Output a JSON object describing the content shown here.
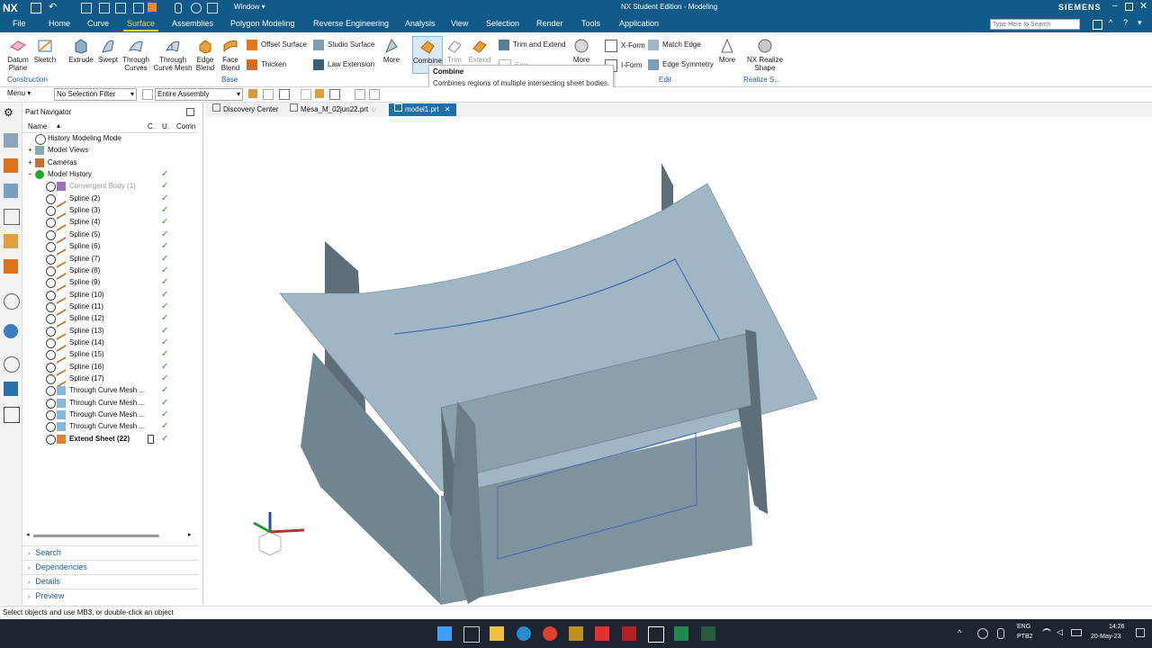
{
  "titlebar": {
    "app": "NX",
    "window_menu": "Window ▾",
    "title": "NX Student Edition - Modeling",
    "brand": "SIEMENS",
    "search_placeholder": "Type Here to Search"
  },
  "menu": {
    "file": "File",
    "tabs": [
      "Home",
      "Curve",
      "Surface",
      "Assemblies",
      "Polygon Modeling",
      "Reverse Engineering",
      "Analysis",
      "View",
      "Selection",
      "Render",
      "Tools",
      "Application"
    ],
    "active": "Surface"
  },
  "ribbon": {
    "construction": {
      "datum_plane": "Datum Plane",
      "sketch": "Sketch",
      "group": "Construction"
    },
    "base": {
      "extrude": "Extrude",
      "swept": "Swept",
      "through_curves": "Through Curves",
      "through_curve_mesh": "Through Curve Mesh",
      "edge_blend": "Edge Blend",
      "face_blend": "Face Blend",
      "offset_surface": "Offset Surface",
      "thicken": "Thicken",
      "studio_surface": "Studio Surface",
      "law_extension": "Law Extension",
      "more": "More",
      "group": "Base"
    },
    "combine_grp": {
      "combine": "Combine",
      "trim": "Trim",
      "extend_sheet": "Extend Sheet",
      "trim_and_extend": "Trim and Extend",
      "sew": "Sew",
      "more": "More"
    },
    "edit": {
      "xform": "X-Form",
      "iform": "I-Form",
      "match_edge": "Match Edge",
      "edge_symmetry": "Edge Symmetry",
      "more": "More",
      "group": "Edit"
    },
    "realize": {
      "nx_realize_shape": "NX Realize Shape",
      "group": "Realize S..."
    }
  },
  "tooltip": {
    "title": "Combine",
    "text": "Combines regions of multiple intersecting sheet bodies."
  },
  "toolbar": {
    "menu": "Menu ▾",
    "filter": "No Selection Filter",
    "scope": "Entire Assembly"
  },
  "doctabs": [
    "Discovery Center",
    "Mesa_M_02jun22.prt",
    "model1.prt"
  ],
  "navigator": {
    "title": "Part Navigator",
    "columns": [
      "Name",
      "C.",
      "U.",
      "Comn"
    ],
    "rows": [
      "History Modeling Mode",
      "Model Views",
      "Cameras",
      "Model History",
      "Convergent Body (1)",
      "Spline (2)",
      "Spline (3)",
      "Spline (4)",
      "Spline (5)",
      "Spline (6)",
      "Spline (7)",
      "Spline (8)",
      "Spline (9)",
      "Spline (10)",
      "Spline (11)",
      "Spline (12)",
      "Spline (13)",
      "Spline (14)",
      "Spline (15)",
      "Spline (16)",
      "Spline (17)",
      "Through Curve Mesh ...",
      "Through Curve Mesh ...",
      "Through Curve Mesh ...",
      "Through Curve Mesh ...",
      "Extend Sheet (22)"
    ],
    "panels": [
      "Search",
      "Dependencies",
      "Details",
      "Preview"
    ]
  },
  "status": "Select objects and use MB3, or double-click an object",
  "taskbar": {
    "lang1": "ENG",
    "lang2": "PTB2",
    "time": "14:26",
    "date": "20-May-23"
  },
  "colors": {
    "accent": "#0f5a88",
    "active_tab": "#ffd24a",
    "surface": "#9fb7c4",
    "check": "#2aa52a"
  }
}
